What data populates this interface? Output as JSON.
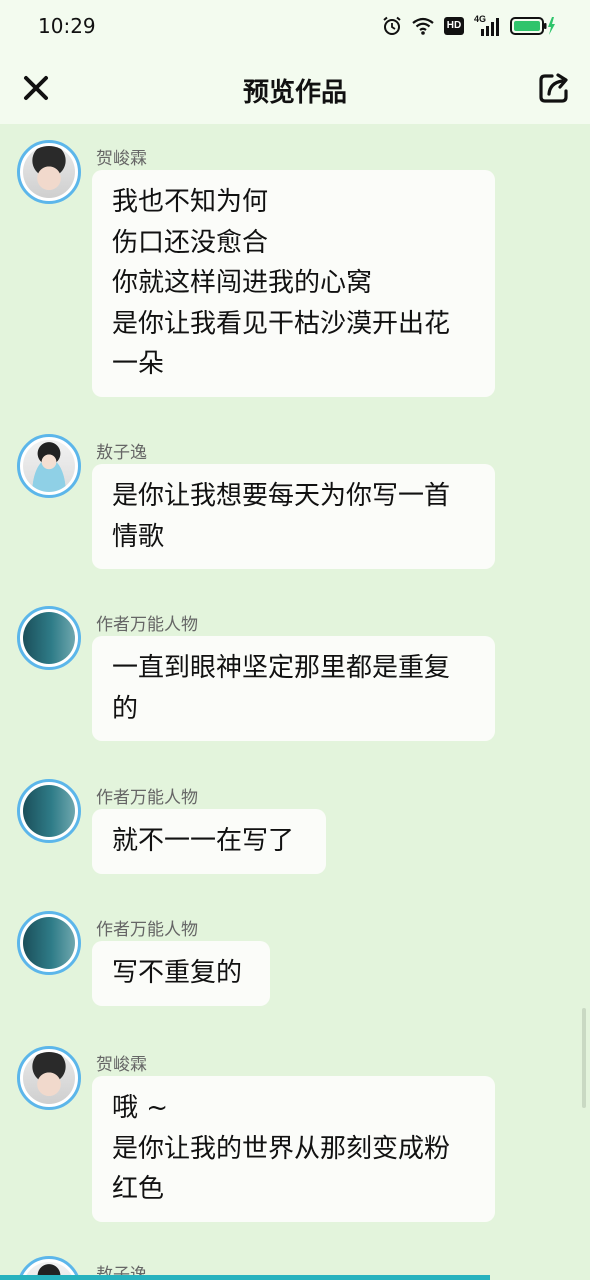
{
  "status_bar": {
    "time": "10:29",
    "hd": "HD",
    "network": "4G"
  },
  "header": {
    "title": "预览作品"
  },
  "messages": [
    {
      "sender": "贺峻霖",
      "text": "我也不知为何\n伤口还没愈合\n你就这样闯进我的心窝\n是你让我看见干枯沙漠开出花\n一朵"
    },
    {
      "sender": "敖子逸",
      "text": "是你让我想要每天为你写一首\n情歌"
    },
    {
      "sender": "作者万能人物",
      "text": "一直到眼神坚定那里都是重复\n的"
    },
    {
      "sender": "作者万能人物",
      "text": "就不一一在写了"
    },
    {
      "sender": "作者万能人物",
      "text": "写不重复的"
    },
    {
      "sender": "贺峻霖",
      "text": "哦 ~\n是你让我的世界从那刻变成粉\n红色"
    },
    {
      "sender": "敖子逸",
      "text": ""
    }
  ]
}
